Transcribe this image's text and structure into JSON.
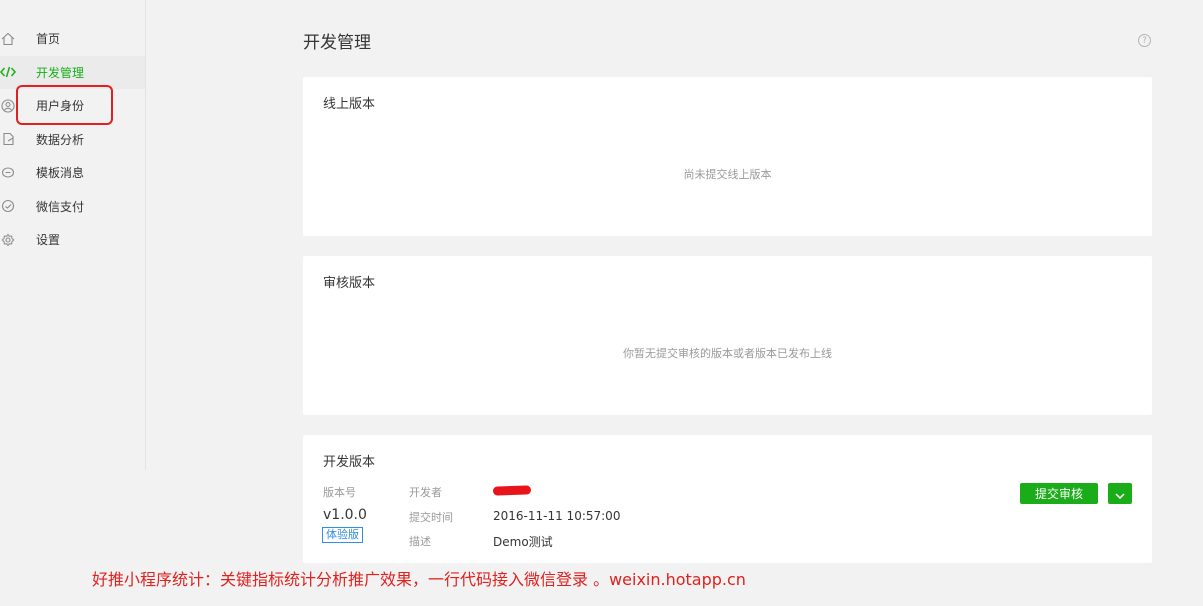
{
  "sidebar": {
    "items": [
      {
        "label": "首页",
        "icon": "home-icon"
      },
      {
        "label": "开发管理",
        "icon": "code-icon",
        "active": true
      },
      {
        "label": "用户身份",
        "icon": "user-icon"
      },
      {
        "label": "数据分析",
        "icon": "chart-icon"
      },
      {
        "label": "模板消息",
        "icon": "message-icon"
      },
      {
        "label": "微信支付",
        "icon": "payment-icon"
      },
      {
        "label": "设置",
        "icon": "gear-icon"
      }
    ]
  },
  "header": {
    "title": "开发管理",
    "help_glyph": "?"
  },
  "online": {
    "title": "线上版本",
    "empty_text": "尚未提交线上版本"
  },
  "review": {
    "title": "审核版本",
    "empty_text": "你暂无提交审核的版本或者版本已发布上线"
  },
  "dev": {
    "title": "开发版本",
    "version_label": "版本号",
    "version_value": "v1.0.0",
    "badge": "体验版",
    "developer_label": "开发者",
    "submit_time_label": "提交时间",
    "submit_time_value": "2016-11-11 10:57:00",
    "desc_label": "描述",
    "desc_value": "Demo测试",
    "submit_button": "提交审核"
  },
  "colors": {
    "accent": "#1aad19",
    "badge": "#2f8ee6",
    "annotation": "#e0211f"
  },
  "watermark": "好推小程序统计：关键指标统计分析推广效果，一行代码接入微信登录 。weixin.hotapp.cn"
}
